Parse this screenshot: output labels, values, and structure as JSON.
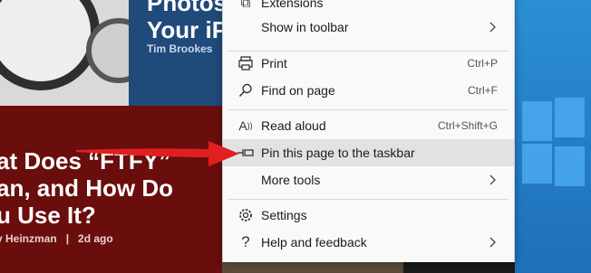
{
  "articles": [
    {
      "title": "Photos\nYour iP",
      "author": "Tim Brookes",
      "separator": "|"
    },
    {
      "title": "at Does “FTFY”\nan, and How Do\nu Use It?",
      "author": "y Heinzman",
      "separator": "|",
      "time": "2d ago"
    }
  ],
  "menu": {
    "items": [
      {
        "label": "Extensions",
        "icon": "extensions-icon"
      },
      {
        "label": "Show in toolbar",
        "submenu": true
      },
      {
        "label": "Print",
        "shortcut": "Ctrl+P",
        "icon": "print-icon"
      },
      {
        "label": "Find on page",
        "shortcut": "Ctrl+F",
        "icon": "search-icon"
      },
      {
        "label": "Read aloud",
        "shortcut": "Ctrl+Shift+G",
        "icon": "read-aloud-icon"
      },
      {
        "label": "Pin this page to the taskbar",
        "icon": "pin-icon",
        "highlighted": true
      },
      {
        "label": "More tools",
        "submenu": true
      },
      {
        "label": "Settings",
        "icon": "gear-icon"
      },
      {
        "label": "Help and feedback",
        "icon": "help-icon",
        "submenu": true
      }
    ]
  },
  "colors": {
    "menu_bg": "#f9f9f9",
    "highlight": "#e2e2e2",
    "arrow": "#e02020",
    "article_red": "#6a0d0d",
    "article_blue": "#1f4a7a",
    "desktop_blue": "#2b8fd6"
  }
}
